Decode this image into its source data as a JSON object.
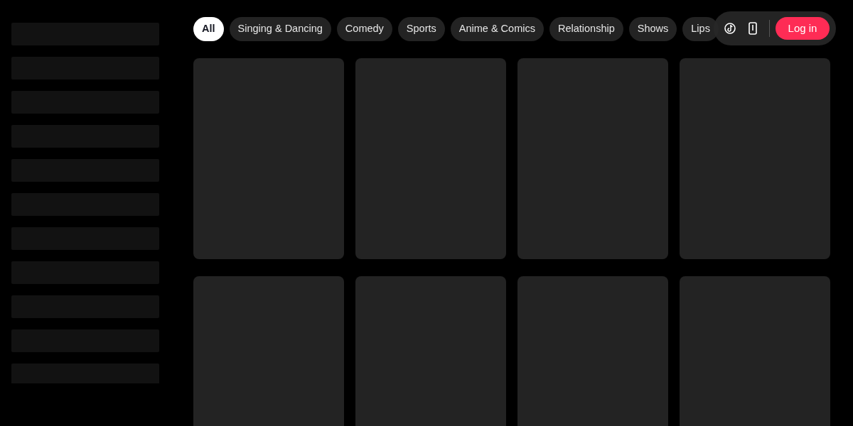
{
  "categories": [
    {
      "label": "All",
      "selected": true
    },
    {
      "label": "Singing & Dancing",
      "selected": false
    },
    {
      "label": "Comedy",
      "selected": false
    },
    {
      "label": "Sports",
      "selected": false
    },
    {
      "label": "Anime & Comics",
      "selected": false
    },
    {
      "label": "Relationship",
      "selected": false
    },
    {
      "label": "Shows",
      "selected": false
    },
    {
      "label": "Lips",
      "selected": false
    }
  ],
  "header_actions": {
    "login_label": "Log in"
  }
}
